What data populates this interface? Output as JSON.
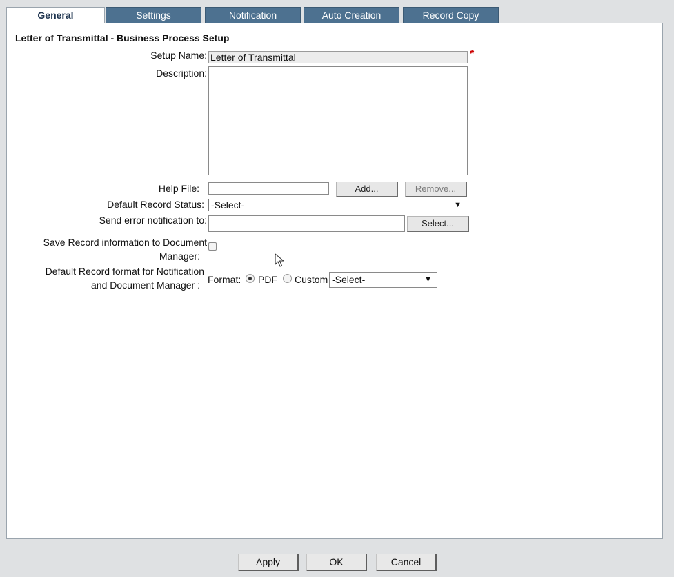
{
  "tabs": [
    "General",
    "Settings",
    "Notification",
    "Auto Creation",
    "Record Copy"
  ],
  "section_title": "Letter of Transmittal - Business Process Setup",
  "fields": {
    "setup_name": {
      "label": "Setup Name:",
      "value": "Letter of Transmittal",
      "required_mark": "*"
    },
    "description": {
      "label": "Description:",
      "value": ""
    },
    "help_file": {
      "label": "Help File:",
      "value": "",
      "add_label": "Add...",
      "remove_label": "Remove..."
    },
    "default_record_status": {
      "label": "Default Record Status:",
      "selected": "-Select-"
    },
    "send_error_notification": {
      "label": "Send error notification to:",
      "value": "",
      "select_label": "Select..."
    },
    "save_record_info": {
      "label_line1": "Save Record information to Document",
      "label_line2": "Manager:",
      "checked": false
    },
    "default_record_format": {
      "label_line1": "Default Record format for Notification",
      "label_line2": "and Document Manager :",
      "format_label": "Format:",
      "options": [
        "PDF",
        "Custom"
      ],
      "selected_option": "PDF",
      "custom_select": "-Select-"
    }
  },
  "footer": {
    "apply": "Apply",
    "ok": "OK",
    "cancel": "Cancel"
  },
  "icons": {
    "dropdown": "chevron-down-icon",
    "cursor": "mouse-pointer-icon"
  }
}
